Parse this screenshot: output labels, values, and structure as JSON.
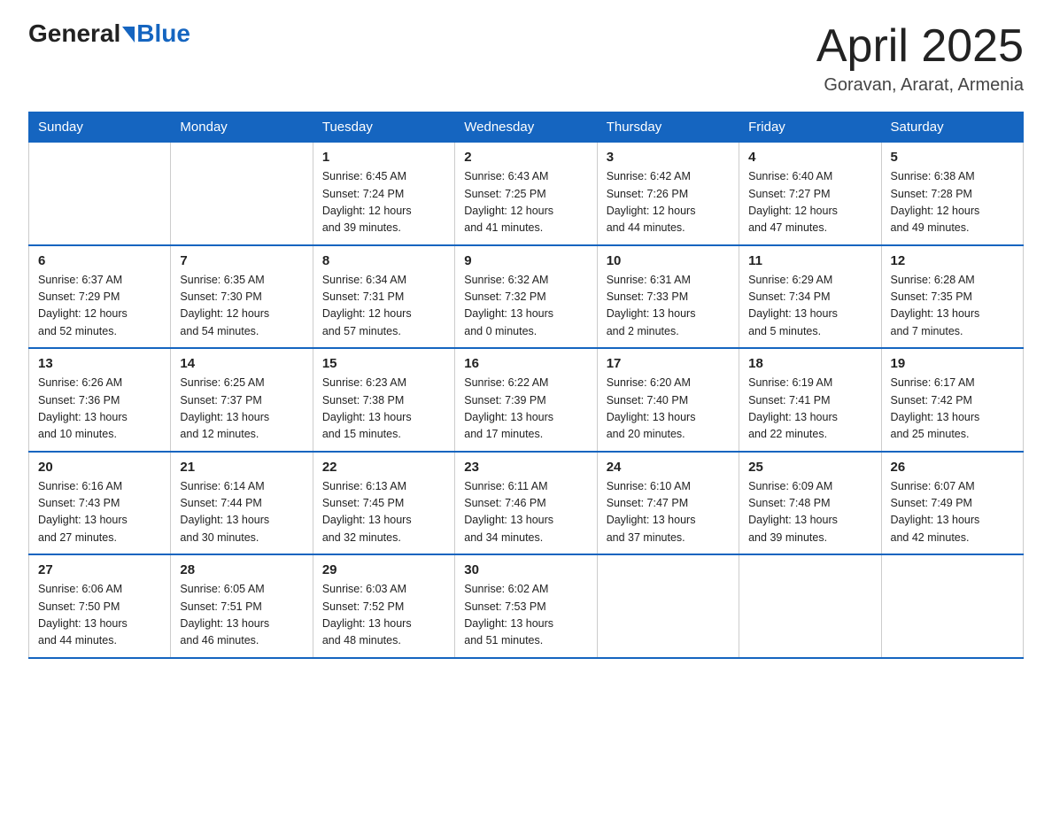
{
  "header": {
    "logo_general": "General",
    "logo_blue": "Blue",
    "month_year": "April 2025",
    "location": "Goravan, Ararat, Armenia"
  },
  "weekdays": [
    "Sunday",
    "Monday",
    "Tuesday",
    "Wednesday",
    "Thursday",
    "Friday",
    "Saturday"
  ],
  "weeks": [
    [
      {
        "day": "",
        "info": ""
      },
      {
        "day": "",
        "info": ""
      },
      {
        "day": "1",
        "info": "Sunrise: 6:45 AM\nSunset: 7:24 PM\nDaylight: 12 hours\nand 39 minutes."
      },
      {
        "day": "2",
        "info": "Sunrise: 6:43 AM\nSunset: 7:25 PM\nDaylight: 12 hours\nand 41 minutes."
      },
      {
        "day": "3",
        "info": "Sunrise: 6:42 AM\nSunset: 7:26 PM\nDaylight: 12 hours\nand 44 minutes."
      },
      {
        "day": "4",
        "info": "Sunrise: 6:40 AM\nSunset: 7:27 PM\nDaylight: 12 hours\nand 47 minutes."
      },
      {
        "day": "5",
        "info": "Sunrise: 6:38 AM\nSunset: 7:28 PM\nDaylight: 12 hours\nand 49 minutes."
      }
    ],
    [
      {
        "day": "6",
        "info": "Sunrise: 6:37 AM\nSunset: 7:29 PM\nDaylight: 12 hours\nand 52 minutes."
      },
      {
        "day": "7",
        "info": "Sunrise: 6:35 AM\nSunset: 7:30 PM\nDaylight: 12 hours\nand 54 minutes."
      },
      {
        "day": "8",
        "info": "Sunrise: 6:34 AM\nSunset: 7:31 PM\nDaylight: 12 hours\nand 57 minutes."
      },
      {
        "day": "9",
        "info": "Sunrise: 6:32 AM\nSunset: 7:32 PM\nDaylight: 13 hours\nand 0 minutes."
      },
      {
        "day": "10",
        "info": "Sunrise: 6:31 AM\nSunset: 7:33 PM\nDaylight: 13 hours\nand 2 minutes."
      },
      {
        "day": "11",
        "info": "Sunrise: 6:29 AM\nSunset: 7:34 PM\nDaylight: 13 hours\nand 5 minutes."
      },
      {
        "day": "12",
        "info": "Sunrise: 6:28 AM\nSunset: 7:35 PM\nDaylight: 13 hours\nand 7 minutes."
      }
    ],
    [
      {
        "day": "13",
        "info": "Sunrise: 6:26 AM\nSunset: 7:36 PM\nDaylight: 13 hours\nand 10 minutes."
      },
      {
        "day": "14",
        "info": "Sunrise: 6:25 AM\nSunset: 7:37 PM\nDaylight: 13 hours\nand 12 minutes."
      },
      {
        "day": "15",
        "info": "Sunrise: 6:23 AM\nSunset: 7:38 PM\nDaylight: 13 hours\nand 15 minutes."
      },
      {
        "day": "16",
        "info": "Sunrise: 6:22 AM\nSunset: 7:39 PM\nDaylight: 13 hours\nand 17 minutes."
      },
      {
        "day": "17",
        "info": "Sunrise: 6:20 AM\nSunset: 7:40 PM\nDaylight: 13 hours\nand 20 minutes."
      },
      {
        "day": "18",
        "info": "Sunrise: 6:19 AM\nSunset: 7:41 PM\nDaylight: 13 hours\nand 22 minutes."
      },
      {
        "day": "19",
        "info": "Sunrise: 6:17 AM\nSunset: 7:42 PM\nDaylight: 13 hours\nand 25 minutes."
      }
    ],
    [
      {
        "day": "20",
        "info": "Sunrise: 6:16 AM\nSunset: 7:43 PM\nDaylight: 13 hours\nand 27 minutes."
      },
      {
        "day": "21",
        "info": "Sunrise: 6:14 AM\nSunset: 7:44 PM\nDaylight: 13 hours\nand 30 minutes."
      },
      {
        "day": "22",
        "info": "Sunrise: 6:13 AM\nSunset: 7:45 PM\nDaylight: 13 hours\nand 32 minutes."
      },
      {
        "day": "23",
        "info": "Sunrise: 6:11 AM\nSunset: 7:46 PM\nDaylight: 13 hours\nand 34 minutes."
      },
      {
        "day": "24",
        "info": "Sunrise: 6:10 AM\nSunset: 7:47 PM\nDaylight: 13 hours\nand 37 minutes."
      },
      {
        "day": "25",
        "info": "Sunrise: 6:09 AM\nSunset: 7:48 PM\nDaylight: 13 hours\nand 39 minutes."
      },
      {
        "day": "26",
        "info": "Sunrise: 6:07 AM\nSunset: 7:49 PM\nDaylight: 13 hours\nand 42 minutes."
      }
    ],
    [
      {
        "day": "27",
        "info": "Sunrise: 6:06 AM\nSunset: 7:50 PM\nDaylight: 13 hours\nand 44 minutes."
      },
      {
        "day": "28",
        "info": "Sunrise: 6:05 AM\nSunset: 7:51 PM\nDaylight: 13 hours\nand 46 minutes."
      },
      {
        "day": "29",
        "info": "Sunrise: 6:03 AM\nSunset: 7:52 PM\nDaylight: 13 hours\nand 48 minutes."
      },
      {
        "day": "30",
        "info": "Sunrise: 6:02 AM\nSunset: 7:53 PM\nDaylight: 13 hours\nand 51 minutes."
      },
      {
        "day": "",
        "info": ""
      },
      {
        "day": "",
        "info": ""
      },
      {
        "day": "",
        "info": ""
      }
    ]
  ]
}
